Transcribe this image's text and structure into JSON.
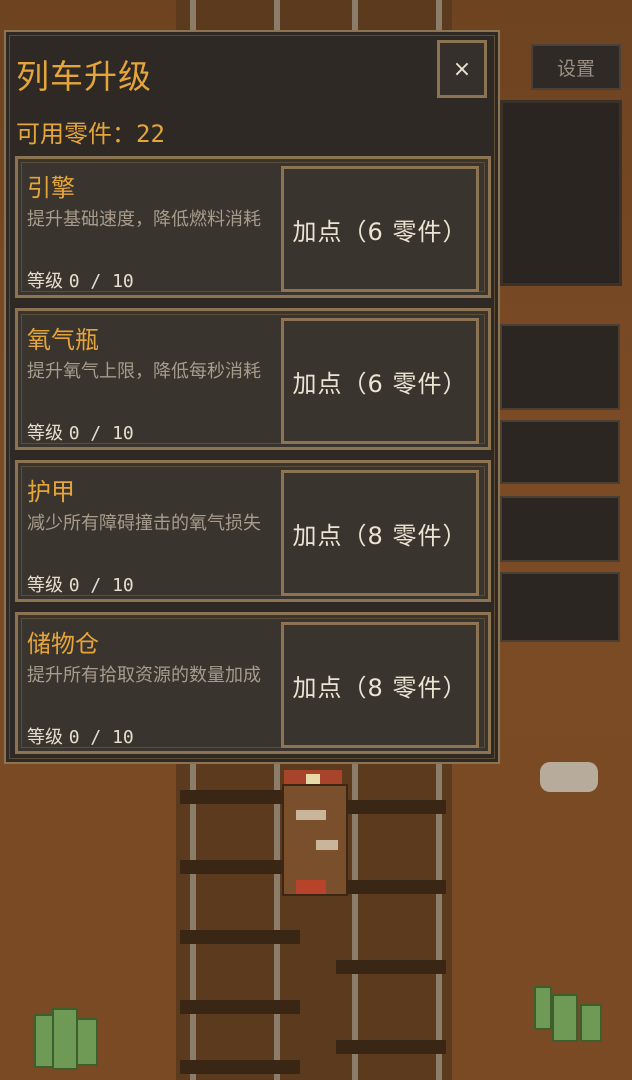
{
  "hud": {
    "settings_label": "设置"
  },
  "modal": {
    "title": "列车升级",
    "close_label": "×",
    "parts_label": "可用零件：",
    "parts_count": "22"
  },
  "upgrades": [
    {
      "name": "引擎",
      "desc": "提升基础速度，降低燃料消耗",
      "level_label": "等级",
      "level": "0 / 10",
      "button": "加点（6 零件）"
    },
    {
      "name": "氧气瓶",
      "desc": "提升氧气上限，降低每秒消耗",
      "level_label": "等级",
      "level": "0 / 10",
      "button": "加点（6 零件）"
    },
    {
      "name": "护甲",
      "desc": "减少所有障碍撞击的氧气损失",
      "level_label": "等级",
      "level": "0 / 10",
      "button": "加点（8 零件）"
    },
    {
      "name": "储物仓",
      "desc": "提升所有拾取资源的数量加成",
      "level_label": "等级",
      "level": "0 / 10",
      "button": "加点（8 零件）"
    }
  ],
  "colors": {
    "accent": "#e6a53a",
    "panel": "#2e2925",
    "border": "#8c7351",
    "ground": "#7a4a24"
  }
}
